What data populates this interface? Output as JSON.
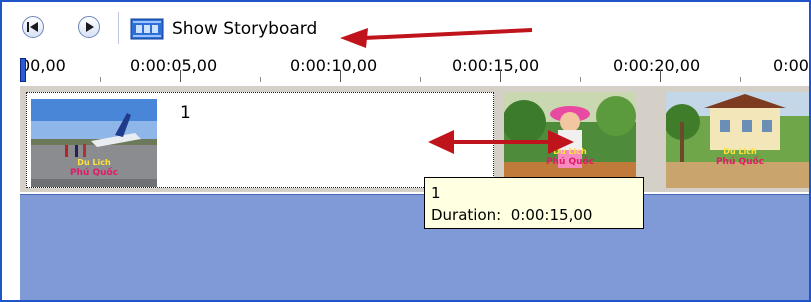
{
  "toolbar": {
    "storyboard_label": "Show Storyboard"
  },
  "ruler": {
    "ticks": [
      "00,00",
      "0:00:05,00",
      "0:00:10,00",
      "0:00:15,00",
      "0:00:20,00",
      "0:00"
    ]
  },
  "clips": [
    {
      "number": "1",
      "thumb_text_top": "Du Lich",
      "thumb_text_main": "Phú Quốc"
    },
    {
      "thumb_text_top": "Du Lich",
      "thumb_text_main": "Phú Quốc"
    },
    {
      "thumb_text_top": "Du Lich",
      "thumb_text_main": "Phú Quốc"
    }
  ],
  "tooltip": {
    "title": "1",
    "duration_label": "Duration:",
    "duration_value": "0:00:15,00"
  },
  "colors": {
    "frame_border": "#1f55c8",
    "audio_track": "#7f9ad6",
    "tooltip_bg": "#ffffe1",
    "annotation_arrow": "#c0141c"
  }
}
